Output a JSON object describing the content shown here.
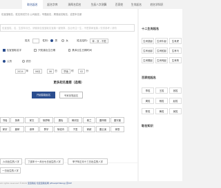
{
  "nav": {
    "tabs": [
      "取名起名",
      "起名字库",
      "测两名用名",
      "生辰八字测算",
      "百家姓",
      "生肖起名",
      "姓名学知识"
    ],
    "active_index": 0
  },
  "form": {
    "hint": "包宝宝取名，姓名测试打分,公司起名，专属起名，周易起名取名，这是本名册",
    "input_placeholder": "包宝宝姓、名，生辰年月日、请使用包宝宝取名宝典一键测算，吉凶专注一生，不是算命宝典 / 仅供参考 / 请勿",
    "surname_label": "姓氏",
    "gender_label": "性别：",
    "gender_options": [
      "男",
      "女"
    ],
    "gender_selected": "男",
    "name_format_label": "姓名结构：",
    "name_format_value": "单 - 双 - 不限",
    "options": [
      "包宝宝取名字",
      "只知道出生日期",
      "具体出生日期时间"
    ],
    "option_selected": 0,
    "calendar_options": [
      "公历",
      "农历"
    ],
    "calendar_selected": "公历",
    "date": {
      "year": "2024",
      "year_unit": "年",
      "month": "06月",
      "day": "06",
      "day_unit": "日",
      "hour": "早晚",
      "hour_unit": "时",
      "minute": "02",
      "minute_unit": "分"
    }
  },
  "more": {
    "title": "更多起名意愿（选填）",
    "submit": "开始智能起名",
    "alt": "专家亲笔起名"
  },
  "name_chips": [
    [
      "书瑶",
      "英奇",
      "家文",
      "徐舒畅",
      "唐怡",
      "蒋欣钰",
      "素兰",
      "唐梓雅",
      "唐宇晨"
    ],
    [
      "家欣",
      "晨研",
      "淑菲",
      "群宇",
      "徐诺舟",
      "子墨",
      "家颖",
      "唐云溪",
      "家辰"
    ]
  ],
  "lower_chips": [
    "六月出生的八字",
    "丁亥年十一月廿七日出生的八字",
    "甲子年正月十三日出生的八字",
    "一日出生的八字"
  ],
  "footer": {
    "text": "All rights reserved  ©2024 ",
    "link": "宝宝取名 包宝宝取名网 (ZhaiqimWang) 京ICP"
  },
  "side": {
    "sections": [
      {
        "title": "十二生肖起名",
        "items": [
          "生肖鼠起",
          "生肖牛起",
          "生肖虎",
          "生肖龙起",
          "生肖蛇起",
          "生肖马",
          "生肖猴起",
          "生肖鸡起",
          "生肖狗"
        ]
      },
      {
        "title": "百家姓起名",
        "items": [
          "李姓",
          "王姓",
          "张姓",
          "周姓",
          "杨姓",
          "赵姓",
          "陈姓",
          "黄姓",
          "吴姓"
        ]
      },
      {
        "title": "取名知识",
        "items": []
      }
    ]
  }
}
